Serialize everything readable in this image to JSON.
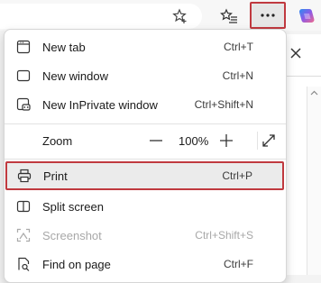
{
  "toolbar": {
    "favorite_icon": "star-plus-icon",
    "favorites_icon": "favorites-star-list-icon",
    "more_icon": "ellipsis-icon",
    "copilot_icon": "copilot-icon"
  },
  "menu": {
    "new_tab": {
      "label": "New tab",
      "shortcut": "Ctrl+T"
    },
    "new_window": {
      "label": "New window",
      "shortcut": "Ctrl+N"
    },
    "new_inprivate": {
      "label": "New InPrivate window",
      "shortcut": "Ctrl+Shift+N"
    },
    "zoom": {
      "label": "Zoom",
      "minus": "—",
      "value": "100%",
      "plus": "+"
    },
    "print": {
      "label": "Print",
      "shortcut": "Ctrl+P"
    },
    "split_screen": {
      "label": "Split screen"
    },
    "screenshot": {
      "label": "Screenshot",
      "shortcut": "Ctrl+Shift+S"
    },
    "find_on_page": {
      "label": "Find on page",
      "shortcut": "Ctrl+F"
    }
  },
  "side": {
    "close": "×"
  },
  "colors": {
    "highlight_border": "#c0393f",
    "highlight_bg": "#ebebeb"
  }
}
